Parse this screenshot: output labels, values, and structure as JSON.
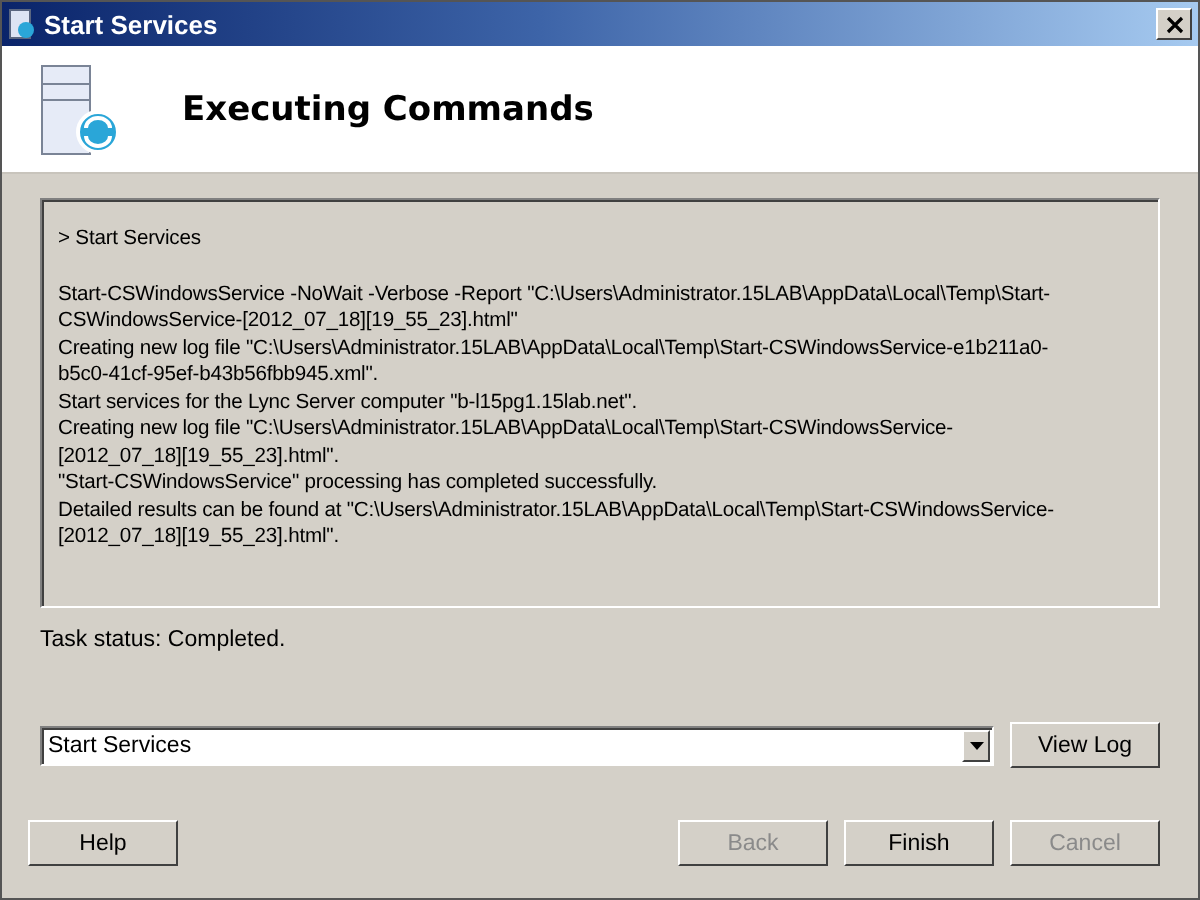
{
  "window": {
    "title": "Start Services"
  },
  "header": {
    "title": "Executing Commands"
  },
  "log": {
    "heading": "> Start Services",
    "lines": [
      "Start-CSWindowsService -NoWait -Verbose -Report \"C:\\Users\\Administrator.15LAB\\AppData\\Local\\Temp\\Start-",
      "CSWindowsService-[2012_07_18][19_55_23].html\"",
      "Creating new log file \"C:\\Users\\Administrator.15LAB\\AppData\\Local\\Temp\\Start-CSWindowsService-e1b211a0-",
      "b5c0-41cf-95ef-b43b56fbb945.xml\".",
      "Start services for the Lync Server computer \"b-l15pg1.15lab.net\".",
      "Creating new log file \"C:\\Users\\Administrator.15LAB\\AppData\\Local\\Temp\\Start-CSWindowsService-",
      "[2012_07_18][19_55_23].html\".",
      "\"Start-CSWindowsService\" processing has completed successfully.",
      "Detailed results can be found at \"C:\\Users\\Administrator.15LAB\\AppData\\Local\\Temp\\Start-CSWindowsService-",
      "[2012_07_18][19_55_23].html\"."
    ]
  },
  "status": "Task status: Completed.",
  "combo": {
    "value": "Start Services"
  },
  "view_log_button": "View Log",
  "buttons": [
    {
      "label": "Help",
      "disabled": false
    },
    {
      "label": "Back",
      "disabled": true
    },
    {
      "label": "Finish",
      "disabled": false
    },
    {
      "label": "Cancel",
      "disabled": true
    }
  ]
}
